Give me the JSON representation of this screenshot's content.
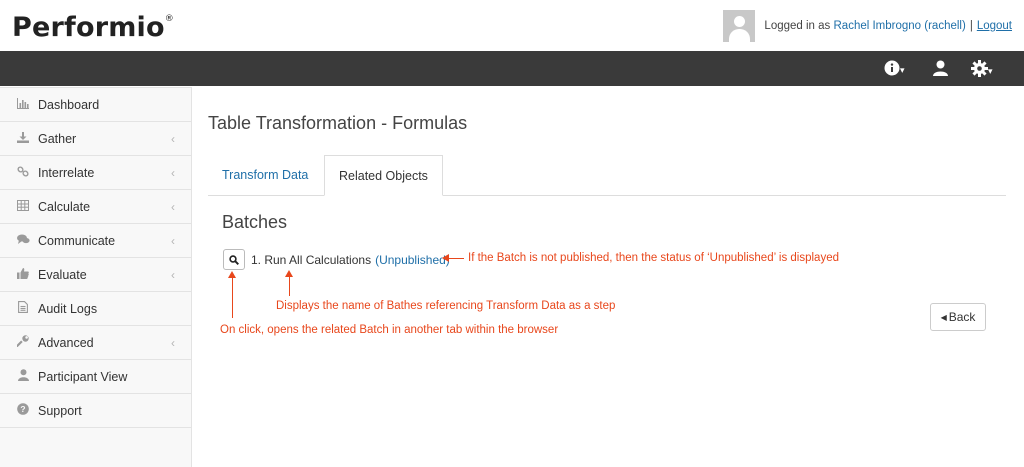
{
  "header": {
    "logo": "Performio",
    "logo_mark": "®",
    "user_prefix": "Logged in as",
    "user_name": "Rachel Imbrogno (rachell)",
    "separator": "|",
    "logout": "Logout"
  },
  "navbar": {
    "icons": [
      "info-icon",
      "user-icon",
      "gear-icon"
    ],
    "dropdown_glyph": "▾"
  },
  "sidebar": {
    "items": [
      {
        "label": "Dashboard",
        "icon": "bar-chart-icon",
        "has_chevron": false
      },
      {
        "label": "Gather",
        "icon": "download-icon",
        "has_chevron": true
      },
      {
        "label": "Interrelate",
        "icon": "link-icon",
        "has_chevron": true
      },
      {
        "label": "Calculate",
        "icon": "table-icon",
        "has_chevron": true
      },
      {
        "label": "Communicate",
        "icon": "chat-icon",
        "has_chevron": true
      },
      {
        "label": "Evaluate",
        "icon": "thumbs-up-icon",
        "has_chevron": true
      },
      {
        "label": "Audit Logs",
        "icon": "file-icon",
        "has_chevron": false
      },
      {
        "label": "Advanced",
        "icon": "wrench-icon",
        "has_chevron": true
      },
      {
        "label": "Participant View",
        "icon": "person-icon",
        "has_chevron": false
      },
      {
        "label": "Support",
        "icon": "help-icon",
        "has_chevron": false
      }
    ]
  },
  "main": {
    "title": "Table Transformation - Formulas",
    "tabs": [
      {
        "label": "Transform Data",
        "active": false
      },
      {
        "label": "Related Objects",
        "active": true
      }
    ],
    "section_title": "Batches",
    "batch": {
      "name": "1. Run All Calculations",
      "status": "(Unpublished)"
    },
    "back_button": "Back"
  },
  "annotations": {
    "status_note": "If the Batch is not published, then the status of ‘Unpublished’ is displayed",
    "name_note": "Displays the name of Bathes referencing Transform Data as a step",
    "click_note": "On click, opens the related Batch in another tab within the browser"
  },
  "colors": {
    "accent": "#1f6fa8",
    "annotation": "#e8471c",
    "navbar": "#3a3a3a"
  }
}
